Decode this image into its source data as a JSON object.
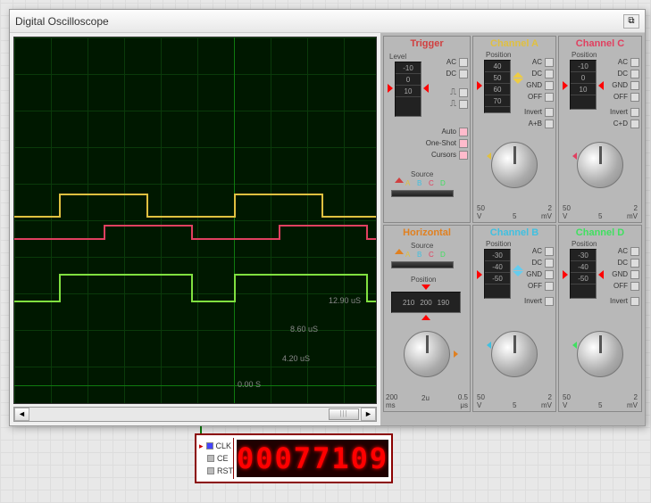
{
  "window": {
    "title": "Digital Oscilloscope"
  },
  "time_labels": [
    "0.00 S",
    "4.20 uS",
    "8.60 uS",
    "12.90 uS"
  ],
  "panels": {
    "trigger": {
      "title": "Trigger",
      "color": "#d04040",
      "level_label": "Level",
      "scale": [
        "-10",
        "0",
        "10"
      ],
      "modes": [
        "AC",
        "DC"
      ],
      "opts": [
        "Auto",
        "One-Shot",
        "Cursors"
      ],
      "source_label": "Source",
      "sources": [
        "A",
        "B",
        "C",
        "D"
      ],
      "source_colors": [
        "#e0c040",
        "#40c0e0",
        "#e04060",
        "#40e060"
      ]
    },
    "horizontal": {
      "title": "Horizontal",
      "color": "#e08020",
      "source_label": "Source",
      "position_label": "Position",
      "pos_values": [
        "210",
        "200",
        "190"
      ],
      "scale_left": "200\nms",
      "scale_mid": "2u",
      "scale_right": "0.5\nμs"
    },
    "chA": {
      "title": "Channel A",
      "color": "#e0c040",
      "pos_label": "Position",
      "scale": [
        "40",
        "50",
        "60",
        "70"
      ],
      "modes": [
        "AC",
        "DC",
        "GND",
        "OFF"
      ],
      "extra": [
        "Invert",
        "A+B"
      ],
      "vL": "50\nV",
      "vM": "5",
      "vR": "2\nmV"
    },
    "chB": {
      "title": "Channel B",
      "color": "#40c0e0",
      "pos_label": "Position",
      "scale": [
        "-30",
        "-40",
        "-50"
      ],
      "modes": [
        "AC",
        "DC",
        "GND",
        "OFF"
      ],
      "extra": [
        "Invert"
      ],
      "vL": "50\nV",
      "vM": "5",
      "vR": "2\nmV"
    },
    "chC": {
      "title": "Channel C",
      "color": "#e04060",
      "pos_label": "Position",
      "scale": [
        "-10",
        "0",
        "10"
      ],
      "modes": [
        "AC",
        "DC",
        "GND",
        "OFF"
      ],
      "extra": [
        "Invert",
        "C+D"
      ],
      "vL": "50\nV",
      "vM": "5",
      "vR": "2\nmV"
    },
    "chD": {
      "title": "Channel D",
      "color": "#40e060",
      "pos_label": "Position",
      "scale": [
        "-30",
        "-40",
        "-50"
      ],
      "modes": [
        "AC",
        "DC",
        "GND",
        "OFF"
      ],
      "extra": [
        "Invert"
      ],
      "vL": "50\nV",
      "vM": "5",
      "vR": "2\nmV"
    }
  },
  "counter": {
    "pins": [
      "CLK",
      "CE",
      "RST"
    ],
    "value": "00077109"
  },
  "chart_data": {
    "type": "oscilloscope",
    "time_axis_us": [
      0.0,
      4.2,
      8.6,
      12.9
    ],
    "traces": [
      {
        "name": "Channel A",
        "color": "#e0c040",
        "y_offset_div": 5.3,
        "waveform": "square",
        "period_us": 8.6,
        "duty": 0.5,
        "amplitude_div": 0.8
      },
      {
        "name": "Channel C",
        "color": "#e04060",
        "y_offset_div": 4.5,
        "waveform": "square",
        "period_us": 8.6,
        "duty": 0.5,
        "amplitude_div": 0.5,
        "phase_shift_us": 2.1
      },
      {
        "name": "Channel B/D",
        "color": "#80e040",
        "y_offset_div": 3.0,
        "waveform": "square",
        "period_us": 8.6,
        "duty": 0.75,
        "amplitude_div": 0.9
      }
    ]
  }
}
